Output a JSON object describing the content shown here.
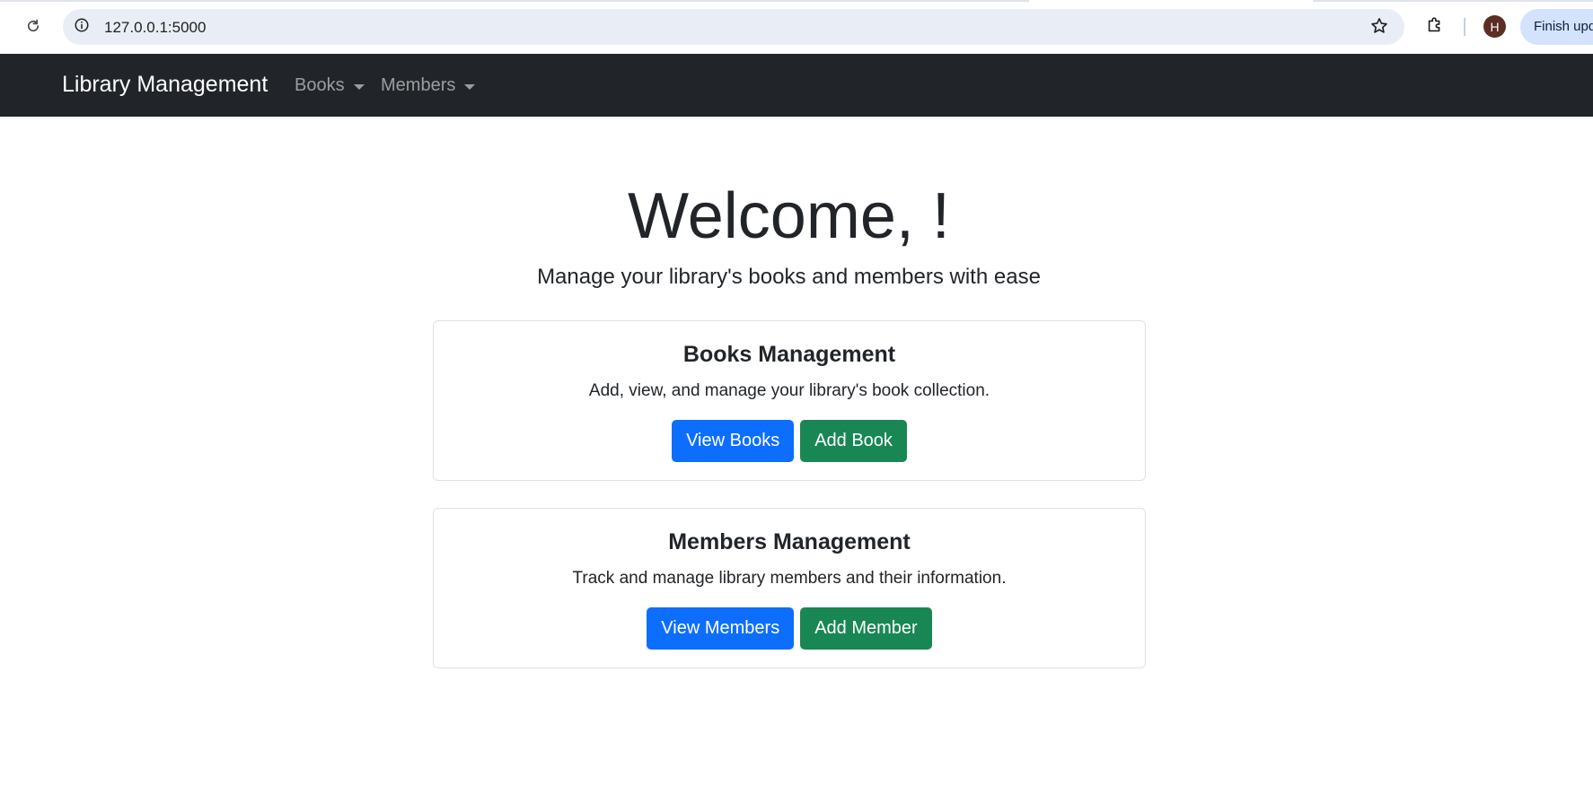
{
  "browser": {
    "url": "127.0.0.1:5000",
    "profile_initial": "H",
    "update_label": "Finish update",
    "icons": [
      "reload-icon",
      "info-icon",
      "star-icon",
      "extensions-icon"
    ]
  },
  "navbar": {
    "brand": "Library Management",
    "menus": [
      {
        "label": "Books"
      },
      {
        "label": "Members"
      }
    ],
    "background": "#212529"
  },
  "hero": {
    "title": "Welcome, !",
    "lead": "Manage your library's books and members with ease"
  },
  "cards": [
    {
      "title": "Books Management",
      "text": "Add, view, and manage your library's book collection.",
      "primary_button": "View Books",
      "secondary_button": "Add Book"
    },
    {
      "title": "Members Management",
      "text": "Track and manage library members and their information.",
      "primary_button": "View Members",
      "secondary_button": "Add Member"
    }
  ],
  "colors": {
    "primary": "#0d6efd",
    "success": "#198754"
  }
}
